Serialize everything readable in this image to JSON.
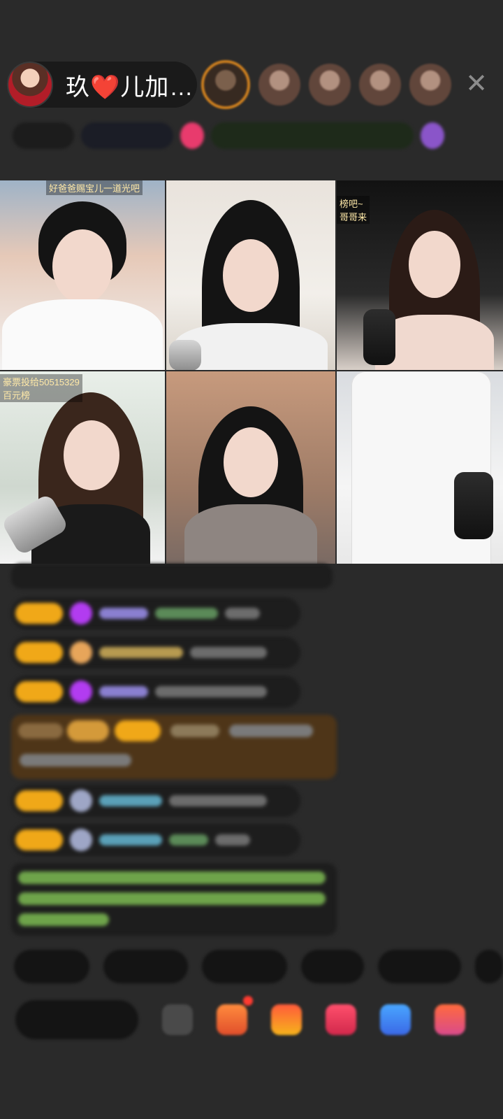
{
  "header": {
    "host_name": "玖❤️儿加…",
    "close_icon": "close-icon"
  },
  "video_tiles": [
    {
      "caption": "好爸爸赐宝儿一道光吧"
    },
    {
      "caption": ""
    },
    {
      "caption": "榜吧~\n哥哥来"
    },
    {
      "caption": "豪票投给50515329\n百元榜"
    },
    {
      "caption": ""
    },
    {
      "caption": ""
    }
  ],
  "colors": {
    "background": "#2a2a2a",
    "level_badge": "#f0a818",
    "system_message": "#8fd14f",
    "highlight_message": "#5a3d1a"
  }
}
